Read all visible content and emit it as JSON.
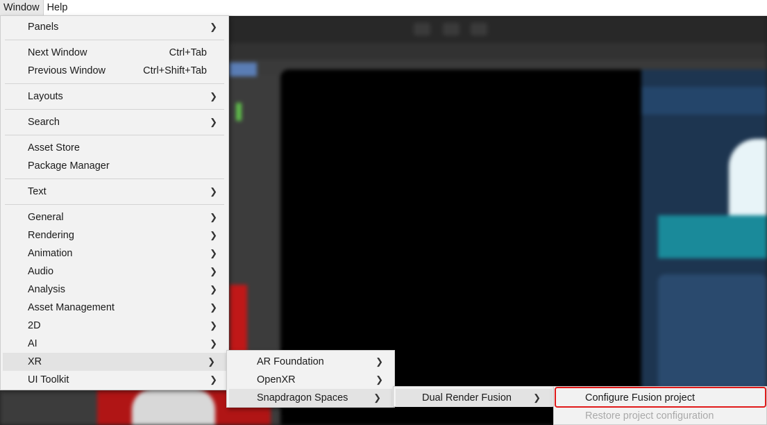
{
  "menubar": {
    "items": [
      "Window",
      "Help"
    ]
  },
  "window_menu": {
    "groups": [
      [
        {
          "label": "Panels",
          "submenu": true
        }
      ],
      [
        {
          "label": "Next Window",
          "shortcut": "Ctrl+Tab"
        },
        {
          "label": "Previous Window",
          "shortcut": "Ctrl+Shift+Tab"
        }
      ],
      [
        {
          "label": "Layouts",
          "submenu": true
        }
      ],
      [
        {
          "label": "Search",
          "submenu": true
        }
      ],
      [
        {
          "label": "Asset Store"
        },
        {
          "label": "Package Manager"
        }
      ],
      [
        {
          "label": "Text",
          "submenu": true
        }
      ],
      [
        {
          "label": "General",
          "submenu": true
        },
        {
          "label": "Rendering",
          "submenu": true
        },
        {
          "label": "Animation",
          "submenu": true
        },
        {
          "label": "Audio",
          "submenu": true
        },
        {
          "label": "Analysis",
          "submenu": true
        },
        {
          "label": "Asset Management",
          "submenu": true
        },
        {
          "label": "2D",
          "submenu": true
        },
        {
          "label": "AI",
          "submenu": true
        },
        {
          "label": "XR",
          "submenu": true,
          "highlighted": true
        },
        {
          "label": "UI Toolkit",
          "submenu": true
        }
      ]
    ]
  },
  "xr_menu": {
    "items": [
      {
        "label": "AR Foundation",
        "submenu": true
      },
      {
        "label": "OpenXR",
        "submenu": true
      },
      {
        "label": "Snapdragon Spaces",
        "submenu": true,
        "highlighted": true
      }
    ]
  },
  "snapdragon_menu": {
    "items": [
      {
        "label": "Dual Render Fusion",
        "submenu": true,
        "highlighted": true
      }
    ]
  },
  "fusion_menu": {
    "items": [
      {
        "label": "Configure Fusion project",
        "annotated": true
      },
      {
        "label": "Restore project configuration",
        "disabled": true
      }
    ]
  },
  "icons": {
    "submenu_arrow": "chevron-right-icon"
  },
  "colors": {
    "annotation": "#e01919",
    "menu_bg": "#f2f2f2",
    "highlight_bg": "#e3e3e3"
  }
}
